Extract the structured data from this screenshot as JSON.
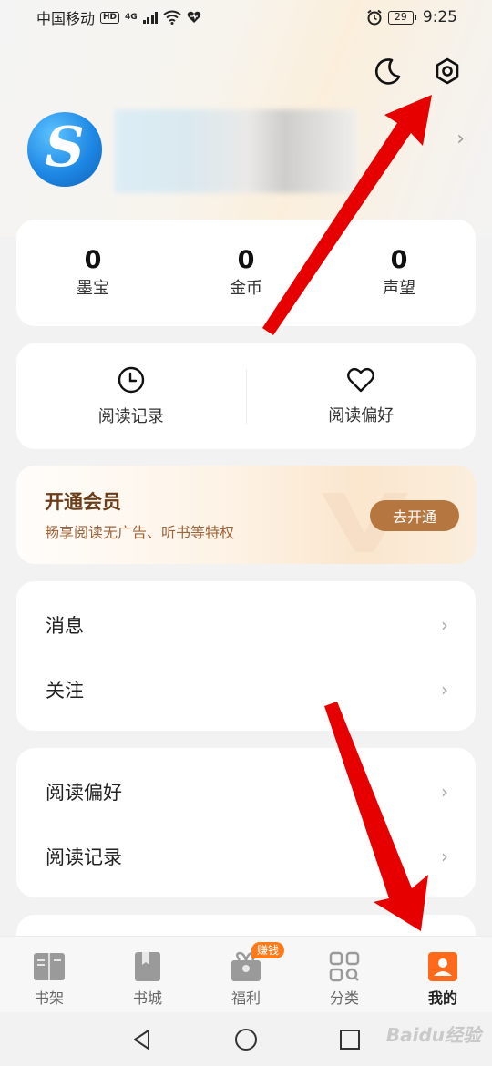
{
  "status_bar": {
    "carrier": "中国移动",
    "hd": "HD",
    "network": "4G",
    "battery": "29",
    "time": "9:25"
  },
  "header": {
    "icons": [
      "moon-icon",
      "settings-gear-icon"
    ]
  },
  "profile": {
    "avatar_letter": "S"
  },
  "stats": [
    {
      "value": "0",
      "label": "墨宝"
    },
    {
      "value": "0",
      "label": "金币"
    },
    {
      "value": "0",
      "label": "声望"
    }
  ],
  "quick_actions": [
    {
      "label": "阅读记录",
      "icon": "clock-icon"
    },
    {
      "label": "阅读偏好",
      "icon": "heart-icon"
    }
  ],
  "vip": {
    "title": "开通会员",
    "subtitle": "畅享阅读无广告、听书等特权",
    "button": "去开通"
  },
  "menu_group_1": [
    {
      "label": "消息"
    },
    {
      "label": "关注"
    }
  ],
  "menu_group_2": [
    {
      "label": "阅读偏好"
    },
    {
      "label": "阅读记录"
    }
  ],
  "tabs": [
    {
      "label": "书架",
      "icon": "bookshelf-icon"
    },
    {
      "label": "书城",
      "icon": "bookstore-icon"
    },
    {
      "label": "福利",
      "icon": "gift-icon",
      "badge": "赚钱"
    },
    {
      "label": "分类",
      "icon": "category-grid-icon"
    },
    {
      "label": "我的",
      "icon": "profile-icon",
      "active": true
    }
  ],
  "colors": {
    "accent_orange": "#ff6a1a",
    "vip_button": "#b5773f",
    "vip_title": "#6b3d19",
    "annotation_arrow": "#e60000"
  },
  "watermark": "Baidu经验"
}
